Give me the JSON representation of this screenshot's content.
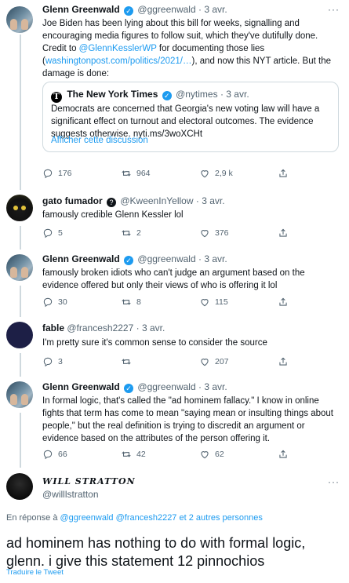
{
  "tweets": [
    {
      "name": "Glenn Greenwald",
      "handle": "@ggreenwald",
      "dot": "·",
      "date": "3 avr.",
      "text_before": "Joe Biden has been lying about this bill for weeks, signalling and encouraging media figures to follow suit, which they've dutifully done. Credit to ",
      "mention": "@GlennKesslerWP",
      "text_middle": " for documenting those lies (",
      "url": "washingtonpost.com/politics/2021/…",
      "text_after": "), and now this NYT article. But the damage is done:",
      "quote": {
        "name": "The New York Times",
        "handle": "@nytimes",
        "dot": "·",
        "date": "3 avr.",
        "text": "Democrats are concerned that Georgia's new voting law will have a significant effect on turnout and electoral outcomes. The evidence suggests otherwise. nyti.ms/3woXCHt",
        "show_thread": "Afficher cette discussion"
      },
      "replies": "176",
      "retweets": "964",
      "likes": "2,9 k"
    },
    {
      "name": "gato fumador",
      "handle": "@KweenInYellow",
      "dot": "·",
      "date": "3 avr.",
      "text": "famously credible Glenn Kessler lol",
      "replies": "5",
      "retweets": "2",
      "likes": "376"
    },
    {
      "name": "Glenn Greenwald",
      "handle": "@ggreenwald",
      "dot": "·",
      "date": "3 avr.",
      "text": "famously broken idiots who can't judge an argument based on the evidence offered but only their views of who is offering it lol",
      "replies": "30",
      "retweets": "8",
      "likes": "115"
    },
    {
      "name": "fable",
      "handle": "@francesh2227",
      "dot": "·",
      "date": "3 avr.",
      "text": "I'm pretty sure it's common sense to consider the source",
      "replies": "3",
      "retweets": "",
      "likes": "207"
    },
    {
      "name": "Glenn Greenwald",
      "handle": "@ggreenwald",
      "dot": "·",
      "date": "3 avr.",
      "text": "In formal logic, that's called the \"ad hominem fallacy.\" I know in online fights that term has come to mean \"saying mean or insulting things about people,\" but the real definition is trying to discredit an argument or evidence based on the attributes of the person offering it.",
      "replies": "66",
      "retweets": "42",
      "likes": "62"
    }
  ],
  "main_tweet": {
    "name": "WILL STRATTON",
    "handle": "@willlstratton",
    "reply_prefix": "En réponse à ",
    "reply_users": "@ggreenwald @francesh2227",
    "reply_suffix": "et 2 autres personnes",
    "text": "ad hominem has nothing to do with formal logic, glenn. i give this statement 12 pinnochios",
    "translate": "Traduire le Tweet"
  },
  "icons": {
    "verified": "✓",
    "more": "···",
    "nyt": "T"
  },
  "colors": {
    "accent": "#1d9bf0",
    "muted": "#536471",
    "border": "#cfd9de"
  }
}
